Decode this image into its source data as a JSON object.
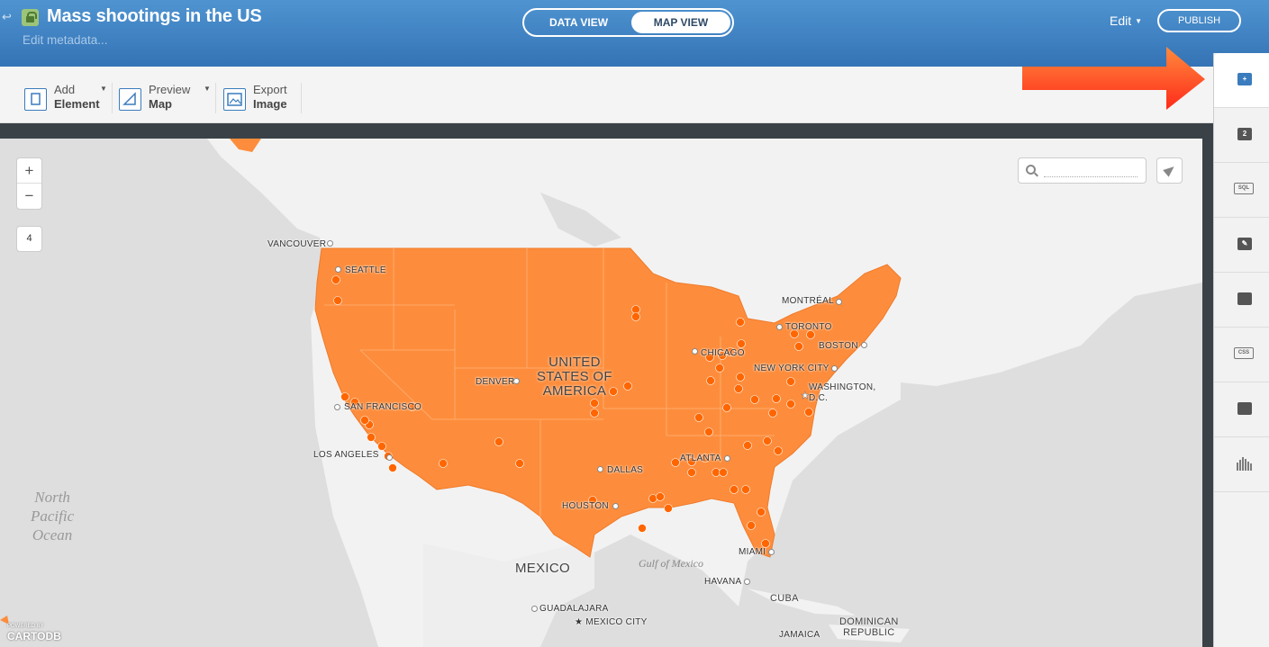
{
  "header": {
    "title": "Mass shootings in the US",
    "subtitle": "Edit metadata...",
    "view_tabs": [
      "DATA VIEW",
      "MAP VIEW"
    ],
    "active_view": "MAP VIEW",
    "edit_label": "Edit",
    "publish_label": "PUBLISH",
    "icons": [
      "back-icon",
      "lock-icon"
    ]
  },
  "toolbar": {
    "add_element": [
      "Add",
      "Element"
    ],
    "preview_map": [
      "Preview",
      "Map"
    ],
    "export_image": [
      "Export",
      "Image"
    ]
  },
  "map": {
    "zoom_in": "+",
    "zoom_out": "−",
    "zoom_level": "4",
    "search_placeholder": "",
    "fill_color": "#fd8d3c",
    "point_color": "#ff6600",
    "cities": [
      "VANCOUVER",
      "SEATTLE",
      "SAN FRANCISCO",
      "LOS ANGELES",
      "DENVER",
      "DALLAS",
      "HOUSTON",
      "CHICAGO",
      "TORONTO",
      "MONTRÉAL",
      "BOSTON",
      "NEW YORK CITY",
      "WASHINGTON,",
      "D.C.",
      "ATLANTA",
      "MIAMI",
      "HAVANA",
      "GUADALAJARA",
      "MEXICO CITY",
      "JAMAICA"
    ],
    "countries": [
      "UNITED",
      "STATES OF",
      "AMERICA",
      "MEXICO",
      "CUBA",
      "DOMINICAN",
      "REPUBLIC"
    ],
    "ocean": [
      "North",
      "Pacific",
      "Ocean"
    ],
    "gulf": "Gulf of Mexico",
    "attribution": [
      "POWERED BY",
      "CARTODB"
    ]
  },
  "sidebar": {
    "items": [
      "layer-add-icon",
      "layer-count-icon",
      "sql-icon",
      "wizard-icon",
      "infowindow-icon",
      "css-icon",
      "legend-icon",
      "filters-icon"
    ],
    "layer_count": "2",
    "sql_label": "SQL",
    "css_label": "CSS"
  }
}
